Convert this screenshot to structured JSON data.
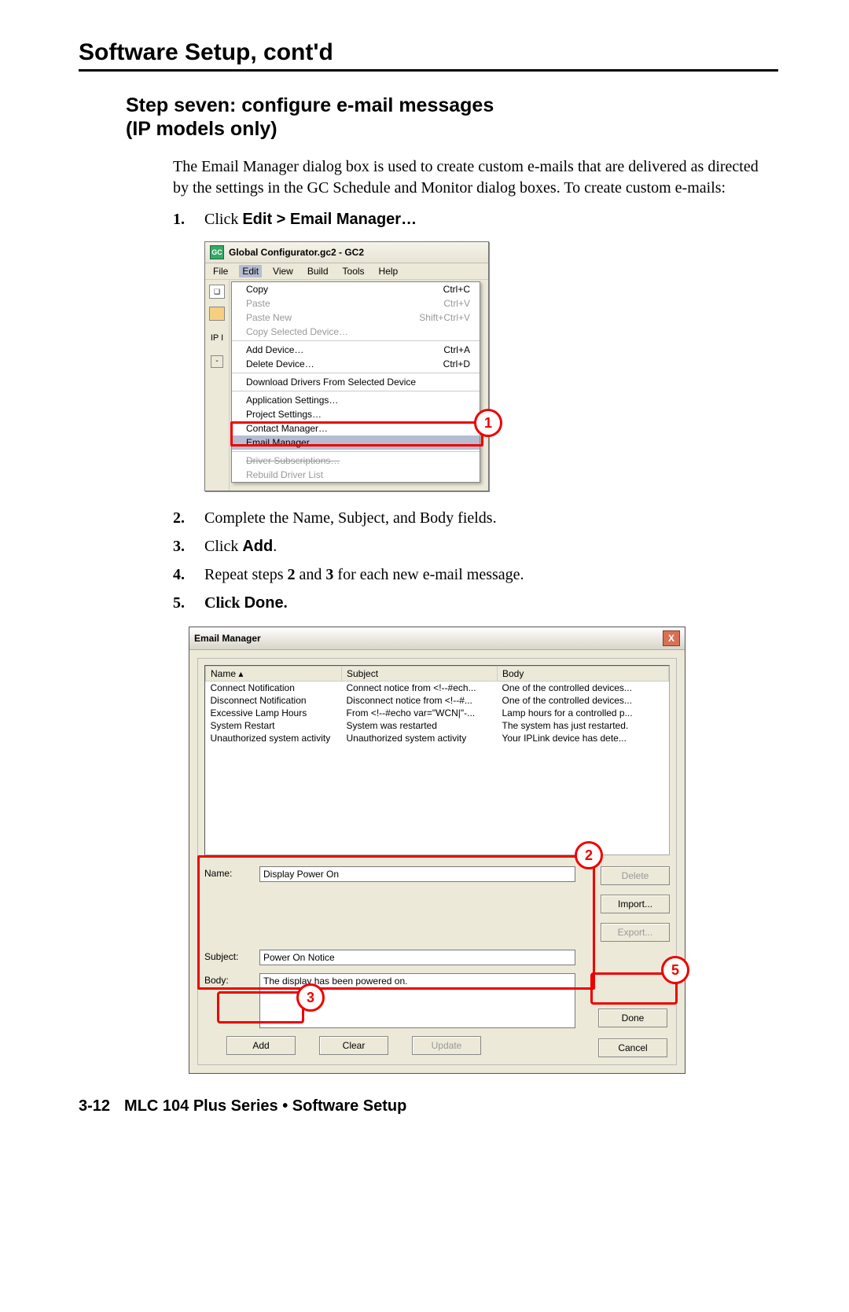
{
  "sectionTitle": "Software Setup, cont'd",
  "stepHeaderLine1": "Step seven: configure e-mail messages",
  "stepHeaderLine2": "(IP models only)",
  "intro": "The Email Manager dialog box is used to create custom e-mails that are delivered as directed by the settings in the GC Schedule and Monitor dialog boxes.  To create custom e-mails:",
  "steps": {
    "s1_pre": "Click ",
    "s1_bold": "Edit > Email Manager…",
    "s2": "Complete the Name, Subject, and Body fields.",
    "s3_pre": "Click ",
    "s3_bold": "Add",
    "s3_post": ".",
    "s4_pre": "Repeat steps ",
    "s4_b1": "2",
    "s4_mid": " and ",
    "s4_b2": "3",
    "s4_post": " for each new e-mail message.",
    "s5_pre": "Click ",
    "s5_bold": "Done",
    "s5_post": "."
  },
  "gc": {
    "title": "Global Configurator.gc2 - GC2",
    "iconText": "GC",
    "menubar": [
      "File",
      "Edit",
      "View",
      "Build",
      "Tools",
      "Help"
    ],
    "leftTxt": "IP I",
    "treeSym": "-",
    "docSym": "❏",
    "menu": {
      "copy": {
        "label": "Copy",
        "short": "Ctrl+C"
      },
      "paste": {
        "label": "Paste",
        "short": "Ctrl+V"
      },
      "pasteNew": {
        "label": "Paste New",
        "short": "Shift+Ctrl+V"
      },
      "copySel": {
        "label": "Copy Selected Device…",
        "short": ""
      },
      "addDev": {
        "label": "Add Device…",
        "short": "Ctrl+A"
      },
      "delDev": {
        "label": "Delete Device…",
        "short": "Ctrl+D"
      },
      "dldrv": {
        "label": "Download Drivers From Selected Device",
        "short": ""
      },
      "appSet": {
        "label": "Application Settings…",
        "short": ""
      },
      "projSet": {
        "label": "Project Settings…",
        "short": ""
      },
      "contact": {
        "label": "Contact Manager…",
        "short": ""
      },
      "email": {
        "label": "Email Manager…",
        "short": ""
      },
      "drvSub": {
        "label": "Driver Subscriptions…",
        "short": ""
      },
      "rebuild": {
        "label": "Rebuild Driver List",
        "short": ""
      }
    },
    "callout": "1"
  },
  "em": {
    "title": "Email Manager",
    "closeSym": "X",
    "cols": {
      "name": "Name  ▴",
      "subject": "Subject",
      "body": "Body"
    },
    "rows": [
      {
        "name": "Connect Notification",
        "subject": "Connect notice from <!--#ech...",
        "body": "One of the controlled devices..."
      },
      {
        "name": "Disconnect Notification",
        "subject": "Disconnect notice from <!--#...",
        "body": "One of the controlled devices..."
      },
      {
        "name": "Excessive Lamp Hours",
        "subject": "From <!--#echo var=\"WCN|\"-...",
        "body": "Lamp hours for a controlled p..."
      },
      {
        "name": "System Restart",
        "subject": "System was restarted",
        "body": "The system has just restarted."
      },
      {
        "name": "Unauthorized system activity",
        "subject": "Unauthorized system activity",
        "body": "Your IPLink device has dete..."
      }
    ],
    "form": {
      "nameLbl": "Name:",
      "nameVal": "Display Power On",
      "subjLbl": "Subject:",
      "subjVal": "Power On Notice",
      "bodyLbl": "Body:",
      "bodyVal": "The display has been powered on."
    },
    "buttons": {
      "delete": "Delete",
      "import": "Import...",
      "export": "Export...",
      "add": "Add",
      "clear": "Clear",
      "update": "Update",
      "done": "Done",
      "cancel": "Cancel"
    },
    "callouts": {
      "c2": "2",
      "c3": "3",
      "c5": "5"
    }
  },
  "footer": {
    "page": "3-12",
    "text": "MLC 104 Plus Series • Software Setup"
  }
}
